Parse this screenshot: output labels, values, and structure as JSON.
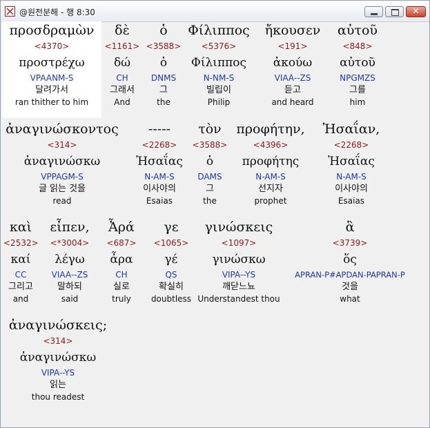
{
  "window": {
    "title": "@원전분해 - 행 8:30"
  },
  "rows": [
    {
      "words": [
        {
          "greek": "προσδραμὼν",
          "number": "<4370>",
          "lemma": "προστρέχω",
          "parsing": "VPAANM-S",
          "korean": "달려가서",
          "english": "ran thither to him"
        },
        {
          "greek": "δὲ",
          "number": "<1161>",
          "lemma": "δώ",
          "parsing": "CH",
          "korean": "그래서",
          "english": "And"
        },
        {
          "greek": "ὁ",
          "number": "<3588>",
          "lemma": "ὁ",
          "parsing": "DNMS",
          "korean": "그",
          "english": "the"
        },
        {
          "greek": "Φίλιππος",
          "number": "<5376>",
          "lemma": "Φίλιππος",
          "parsing": "N-NM-S",
          "korean": "빌립이",
          "english": "Philip"
        },
        {
          "greek": "ἤκουσεν",
          "number": "<191>",
          "lemma": "ἀκούω",
          "parsing": "VIAA--ZS",
          "korean": "듣고",
          "english": "and heard"
        },
        {
          "greek": "αὐτοῦ",
          "number": "<848>",
          "lemma": "αὐτοῦ",
          "parsing": "NPGMZS",
          "korean": "그를",
          "english": "him"
        }
      ]
    },
    {
      "words": [
        {
          "greek": "ἀναγινώσκοντος",
          "number": "<314>",
          "lemma": "ἀναγινώσκω",
          "parsing": "VPPAGM-S",
          "korean": "글 읽는 것을",
          "english": "read"
        },
        {
          "greek": "-----",
          "number": "<2268>",
          "lemma": "Ἠσαΐας",
          "parsing": "N-AM-S",
          "korean": "이사야의",
          "english": "Esaias"
        },
        {
          "greek": "τὸν",
          "number": "<3588>",
          "lemma": "ὁ",
          "parsing": "DAMS",
          "korean": "그",
          "english": "the"
        },
        {
          "greek": "προφήτην,",
          "number": "<4396>",
          "lemma": "προφήτης",
          "parsing": "N-AM-S",
          "korean": "선지자",
          "english": "prophet"
        },
        {
          "greek": "Ἠσαΐαν,",
          "number": "<2268>",
          "lemma": "Ἠσαΐας",
          "parsing": "N-AM-S",
          "korean": "이사야의",
          "english": "Esaias"
        }
      ]
    },
    {
      "words": [
        {
          "greek": "καὶ",
          "number": "<2532>",
          "lemma": "καί",
          "parsing": "CC",
          "korean": "그리고",
          "english": "and"
        },
        {
          "greek": "εἶπεν,",
          "number": "<*3004>",
          "lemma": "λέγω",
          "parsing": "VIAA--ZS",
          "korean": "말하되",
          "english": "said"
        },
        {
          "greek": "Ἆρά",
          "number": "<687>",
          "lemma": "ἆρα",
          "parsing": "CH",
          "korean": "실로",
          "english": "truly"
        },
        {
          "greek": "γε",
          "number": "<1065>",
          "lemma": "γέ",
          "parsing": "QS",
          "korean": "확실히",
          "english": "doubtless"
        },
        {
          "greek": "γινώσκεις",
          "number": "<1097>",
          "lemma": "γινώσκω",
          "parsing": "VIPA--YS",
          "korean": "깨닫느뇨",
          "english": "Understandest thou"
        },
        {
          "greek": "ἃ",
          "number": "<3739>",
          "lemma": "ὅς",
          "parsing": "APRAN-P#APDAN-PAPRAN-P",
          "korean": "것을",
          "english": "what"
        }
      ]
    },
    {
      "words": [
        {
          "greek": "ἀναγινώσκεις;",
          "number": "<314>",
          "lemma": "ἀναγινώσκω",
          "parsing": "VIPA--YS",
          "korean": "읽는",
          "english": "thou readest"
        }
      ]
    }
  ]
}
